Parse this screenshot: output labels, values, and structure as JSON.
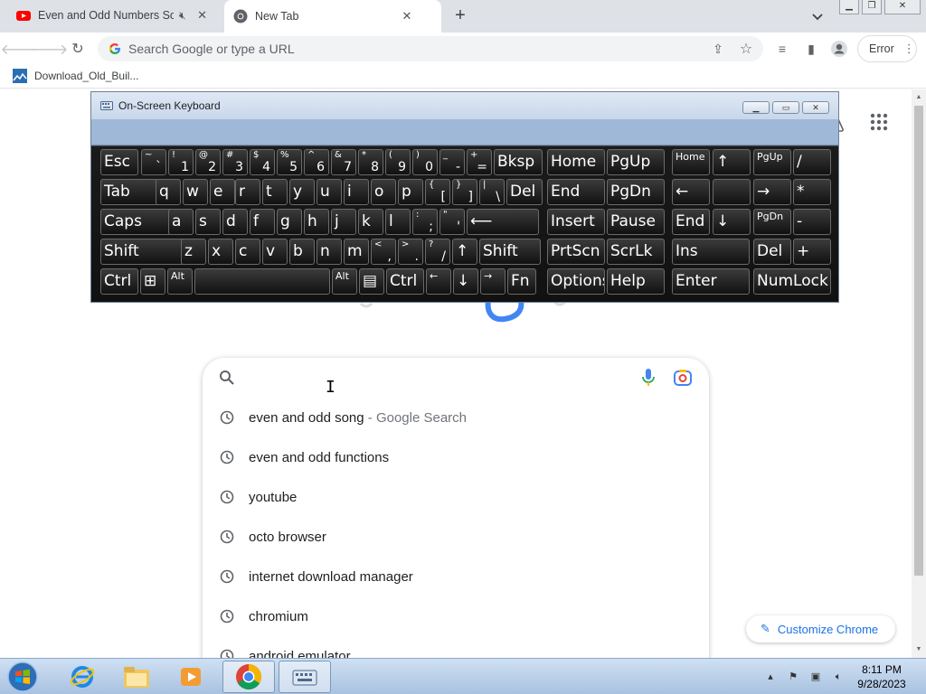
{
  "browser": {
    "tabs": [
      {
        "title": "Even and Odd Numbers Son",
        "favicon": "youtube-icon",
        "muted": true
      },
      {
        "title": "New Tab",
        "favicon": "chrome-icon",
        "active": true
      }
    ],
    "new_tab_symbol": "+",
    "omnibox_placeholder": "Search Google or type a URL",
    "profile_button": "Error",
    "bookmarks": [
      {
        "label": "Download_Old_Buil...",
        "icon": "bookmark-image-icon"
      }
    ]
  },
  "newtab": {
    "search_cursor": "I",
    "suggestions": [
      {
        "text": "even and odd song",
        "sub": " - Google Search"
      },
      {
        "text": "even and odd functions",
        "sub": ""
      },
      {
        "text": "youtube",
        "sub": ""
      },
      {
        "text": "octo browser",
        "sub": ""
      },
      {
        "text": "internet download manager",
        "sub": ""
      },
      {
        "text": "chromium",
        "sub": ""
      },
      {
        "text": "android emulator",
        "sub": ""
      }
    ],
    "customize_label": "Customize Chrome"
  },
  "osk": {
    "title": "On-Screen Keyboard",
    "rows": [
      [
        {
          "t": "",
          "b": "",
          "l": "Esc"
        },
        {
          "t": "~",
          "b": "`"
        },
        {
          "t": "!",
          "b": "1"
        },
        {
          "t": "@",
          "b": "2"
        },
        {
          "t": "#",
          "b": "3"
        },
        {
          "t": "$",
          "b": "4"
        },
        {
          "t": "%",
          "b": "5"
        },
        {
          "t": "^",
          "b": "6"
        },
        {
          "t": "&",
          "b": "7"
        },
        {
          "t": "*",
          "b": "8"
        },
        {
          "t": "(",
          "b": "9"
        },
        {
          "t": ")",
          "b": "0"
        },
        {
          "t": "_",
          "b": "-"
        },
        {
          "t": "+",
          "b": "="
        },
        {
          "l": "Bksp"
        },
        {
          "l": "Home"
        },
        {
          "l": "PgUp"
        },
        {
          "l": "Home",
          "small": true
        },
        {
          "l": "↑"
        },
        {
          "l": "PgUp",
          "small": true
        },
        {
          "l": "/"
        }
      ],
      [
        {
          "l": "Tab"
        },
        {
          "l": "q"
        },
        {
          "l": "w"
        },
        {
          "l": "e"
        },
        {
          "l": "r"
        },
        {
          "l": "t"
        },
        {
          "l": "y"
        },
        {
          "l": "u"
        },
        {
          "l": "i"
        },
        {
          "l": "o"
        },
        {
          "l": "p"
        },
        {
          "t": "{",
          "b": "["
        },
        {
          "t": "}",
          "b": "]"
        },
        {
          "t": "|",
          "b": "\\"
        },
        {
          "l": "Del"
        },
        {
          "l": "End"
        },
        {
          "l": "PgDn"
        },
        {
          "l": "←"
        },
        {
          "l": ""
        },
        {
          "l": "→"
        },
        {
          "l": "*"
        }
      ],
      [
        {
          "l": "Caps"
        },
        {
          "l": "a"
        },
        {
          "l": "s"
        },
        {
          "l": "d"
        },
        {
          "l": "f"
        },
        {
          "l": "g"
        },
        {
          "l": "h"
        },
        {
          "l": "j"
        },
        {
          "l": "k"
        },
        {
          "l": "l"
        },
        {
          "t": ":",
          "b": ";"
        },
        {
          "t": "\"",
          "b": "'"
        },
        {
          "l": "⟵"
        },
        {
          "l": "Insert"
        },
        {
          "l": "Pause"
        },
        {
          "l": "End"
        },
        {
          "l": "↓"
        },
        {
          "l": "PgDn",
          "small": true
        },
        {
          "l": "-"
        }
      ],
      [
        {
          "l": "Shift"
        },
        {
          "l": "z"
        },
        {
          "l": "x"
        },
        {
          "l": "c"
        },
        {
          "l": "v"
        },
        {
          "l": "b"
        },
        {
          "l": "n"
        },
        {
          "l": "m"
        },
        {
          "t": "<",
          "b": ","
        },
        {
          "t": ">",
          "b": "."
        },
        {
          "t": "?",
          "b": "/"
        },
        {
          "l": "↑"
        },
        {
          "l": "Shift"
        },
        {
          "l": "PrtScn"
        },
        {
          "l": "ScrLk"
        },
        {
          "l": "Ins"
        },
        {
          "l": "Del"
        },
        {
          "l": "+"
        }
      ],
      [
        {
          "l": "Ctrl"
        },
        {
          "l": "⊞"
        },
        {
          "l": "Alt",
          "small": true
        },
        {
          "l": ""
        },
        {
          "l": "Alt",
          "small": true
        },
        {
          "l": "▤"
        },
        {
          "l": "Ctrl"
        },
        {
          "l": "←",
          "small": true
        },
        {
          "l": "↓"
        },
        {
          "l": "→",
          "small": true
        },
        {
          "l": "Fn"
        },
        {
          "l": "Options"
        },
        {
          "l": "Help"
        },
        {
          "l": "Enter"
        },
        {
          "l": "NumLock"
        }
      ]
    ]
  },
  "taskbar": {
    "apps": [
      "internet-explorer-icon",
      "folder-icon",
      "media-player-icon",
      "chrome-icon",
      "on-screen-keyboard-icon"
    ],
    "time": "8:11 PM",
    "date": "9/28/2023"
  },
  "colors": {
    "google_blue": "#4285f4",
    "accent": "#1a73e8"
  }
}
